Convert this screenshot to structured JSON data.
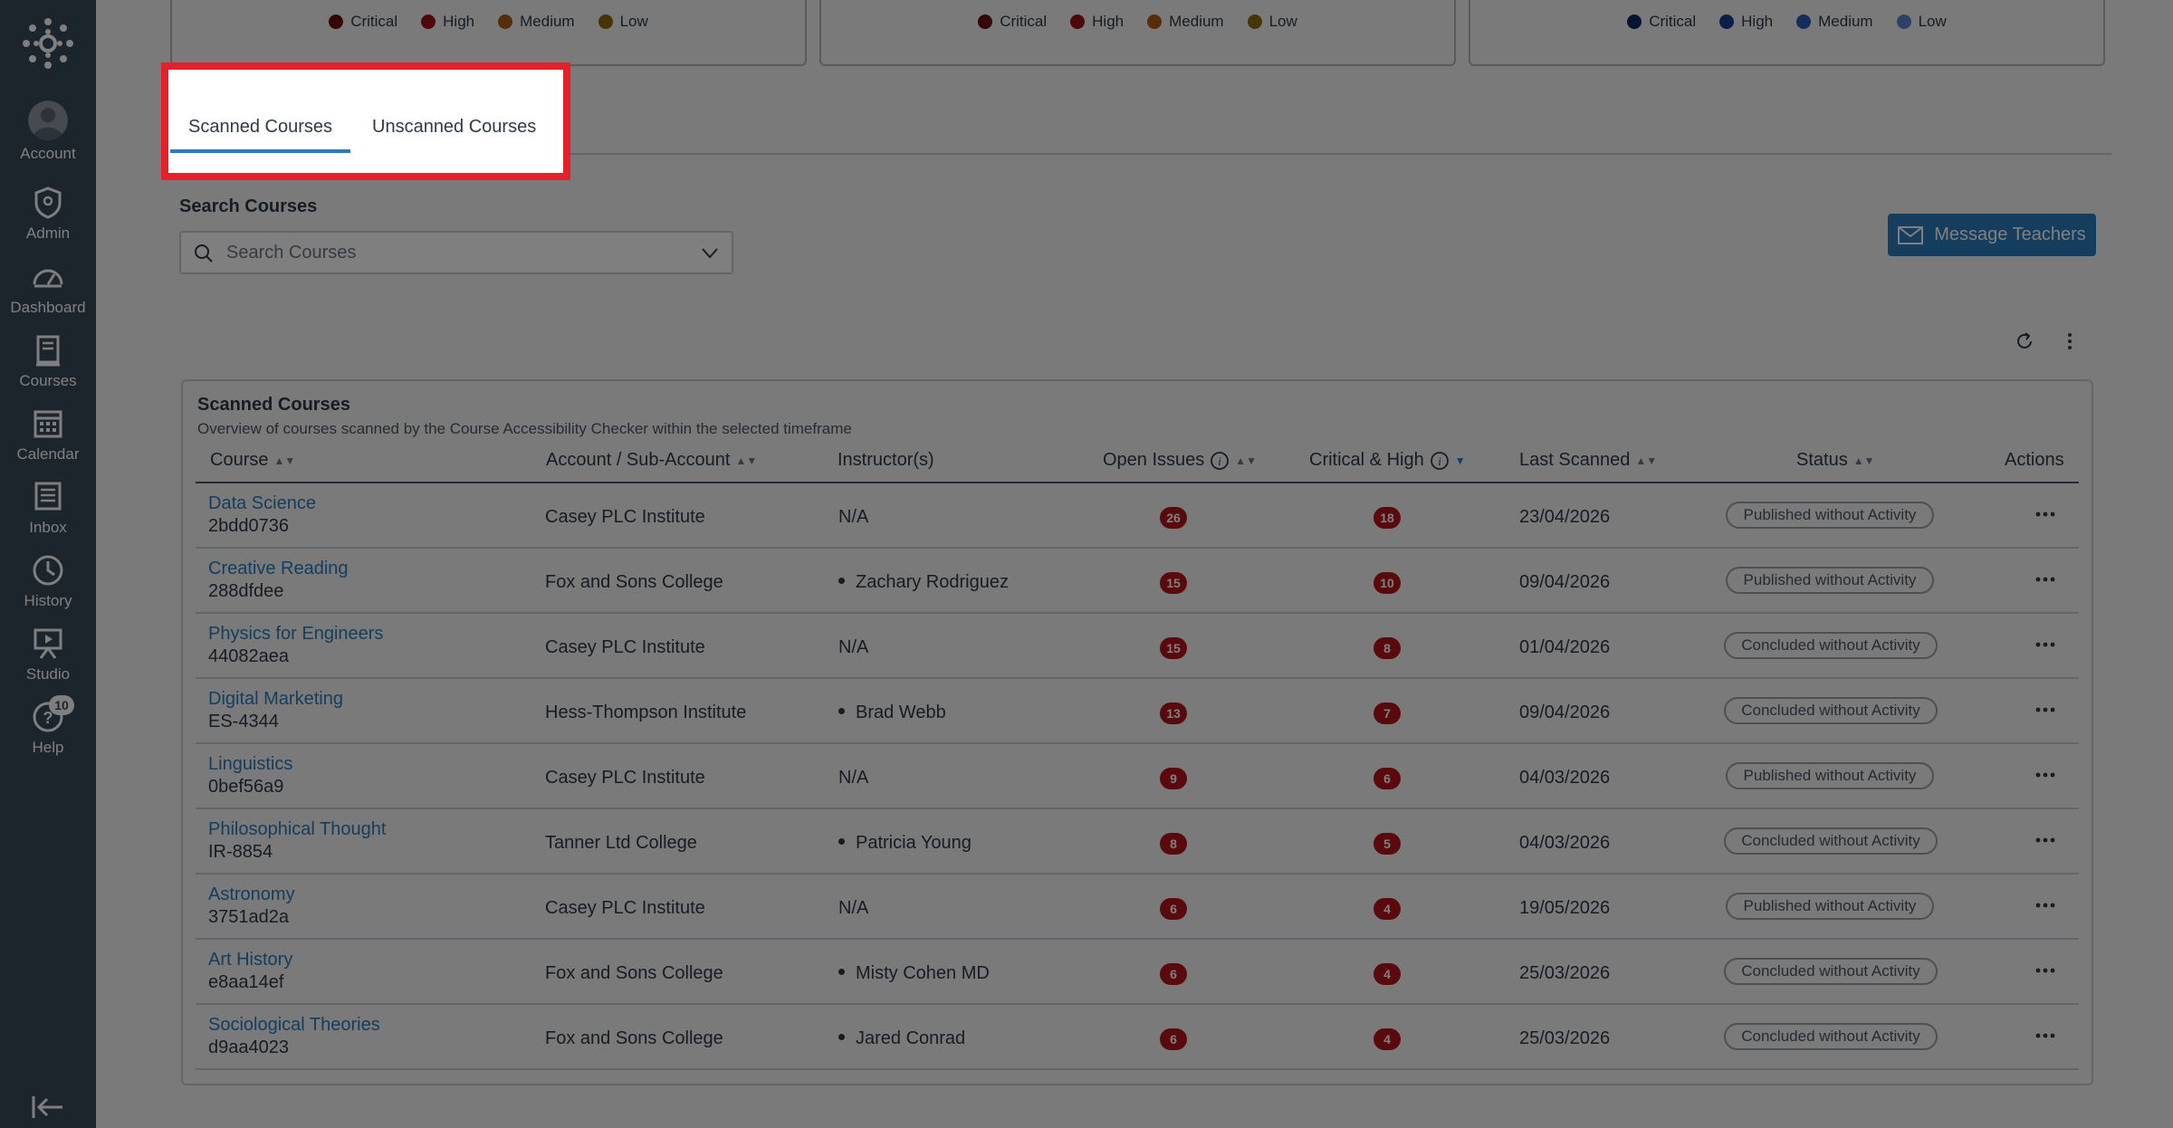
{
  "nav": {
    "items": [
      {
        "label": "Account",
        "icon": "account-icon"
      },
      {
        "label": "Admin",
        "icon": "admin-icon"
      },
      {
        "label": "Dashboard",
        "icon": "dashboard-icon"
      },
      {
        "label": "Courses",
        "icon": "courses-icon"
      },
      {
        "label": "Calendar",
        "icon": "calendar-icon"
      },
      {
        "label": "Inbox",
        "icon": "inbox-icon"
      },
      {
        "label": "History",
        "icon": "history-icon"
      },
      {
        "label": "Studio",
        "icon": "studio-icon"
      },
      {
        "label": "Help",
        "icon": "help-icon"
      }
    ],
    "help_badge": "10"
  },
  "legends": [
    {
      "items": [
        {
          "label": "Critical",
          "color": "#6b0a0e"
        },
        {
          "label": "High",
          "color": "#9e1115"
        },
        {
          "label": "Medium",
          "color": "#b05a17"
        },
        {
          "label": "Low",
          "color": "#8a6a12"
        }
      ]
    },
    {
      "items": [
        {
          "label": "Critical",
          "color": "#6b0a0e"
        },
        {
          "label": "High",
          "color": "#9e1115"
        },
        {
          "label": "Medium",
          "color": "#b05a17"
        },
        {
          "label": "Low",
          "color": "#8a6a12"
        }
      ]
    },
    {
      "items": [
        {
          "label": "Critical",
          "color": "#0c2a63"
        },
        {
          "label": "High",
          "color": "#183f8e"
        },
        {
          "label": "Medium",
          "color": "#2d5bb3"
        },
        {
          "label": "Low",
          "color": "#5b84c9"
        }
      ]
    }
  ],
  "tabs": [
    {
      "label": "Scanned Courses",
      "selected": true
    },
    {
      "label": "Unscanned Courses",
      "selected": false
    }
  ],
  "search": {
    "label": "Search Courses",
    "placeholder": "Search Courses"
  },
  "message_button": "Message Teachers",
  "table": {
    "title": "Scanned Courses",
    "subtitle": "Overview of courses scanned by the Course Accessibility Checker within the selected timeframe",
    "headers": {
      "course": "Course",
      "account": "Account / Sub-Account",
      "instructors": "Instructor(s)",
      "open_issues": "Open Issues",
      "critical_high": "Critical & High",
      "last_scanned": "Last Scanned",
      "status": "Status",
      "actions": "Actions"
    },
    "rows": [
      {
        "name": "Data Science",
        "code": "2bdd0736",
        "account": "Casey PLC Institute",
        "instructor": "N/A",
        "open": "26",
        "crit": "18",
        "date": "23/04/2026",
        "status": "Published without Activity",
        "status_type": "pub"
      },
      {
        "name": "Creative Reading",
        "code": "288dfdee",
        "account": "Fox and Sons College",
        "instructor": "Zachary Rodriguez",
        "open": "15",
        "crit": "10",
        "date": "09/04/2026",
        "status": "Published without Activity",
        "status_type": "pub"
      },
      {
        "name": "Physics for Engineers",
        "code": "44082aea",
        "account": "Casey PLC Institute",
        "instructor": "N/A",
        "open": "15",
        "crit": "8",
        "date": "01/04/2026",
        "status": "Concluded without Activity",
        "status_type": "con"
      },
      {
        "name": "Digital Marketing",
        "code": "ES-4344",
        "account": "Hess-Thompson Institute",
        "instructor": "Brad Webb",
        "open": "13",
        "crit": "7",
        "date": "09/04/2026",
        "status": "Concluded without Activity",
        "status_type": "con"
      },
      {
        "name": "Linguistics",
        "code": "0bef56a9",
        "account": "Casey PLC Institute",
        "instructor": "N/A",
        "open": "9",
        "crit": "6",
        "date": "04/03/2026",
        "status": "Published without Activity",
        "status_type": "pub"
      },
      {
        "name": "Philosophical Thought",
        "code": "IR-8854",
        "account": "Tanner Ltd College",
        "instructor": "Patricia Young",
        "open": "8",
        "crit": "5",
        "date": "04/03/2026",
        "status": "Concluded without Activity",
        "status_type": "con"
      },
      {
        "name": "Astronomy",
        "code": "3751ad2a",
        "account": "Casey PLC Institute",
        "instructor": "N/A",
        "open": "6",
        "crit": "4",
        "date": "19/05/2026",
        "status": "Published without Activity",
        "status_type": "pub"
      },
      {
        "name": "Art History",
        "code": "e8aa14ef",
        "account": "Fox and Sons College",
        "instructor": "Misty Cohen MD",
        "open": "6",
        "crit": "4",
        "date": "25/03/2026",
        "status": "Concluded without Activity",
        "status_type": "con"
      },
      {
        "name": "Sociological Theories",
        "code": "d9aa4023",
        "account": "Fox and Sons College",
        "instructor": "Jared Conrad",
        "open": "6",
        "crit": "4",
        "date": "25/03/2026",
        "status": "Concluded without Activity",
        "status_type": "con"
      }
    ]
  }
}
